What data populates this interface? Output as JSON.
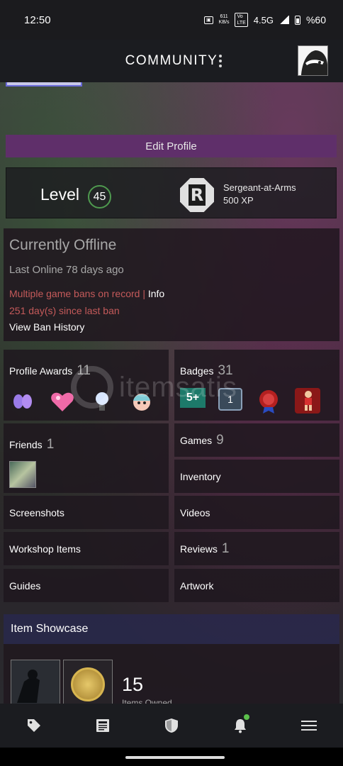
{
  "status_bar": {
    "time": "12:50",
    "net_speed_value": "611",
    "net_speed_unit": "KB/s",
    "network": "4.5G",
    "battery": "%60"
  },
  "header": {
    "title": "COMMUNITY"
  },
  "profile": {
    "edit_label": "Edit Profile",
    "level_label": "Level",
    "level_value": "45",
    "rank_letter": "R",
    "rank_title": "Sergeant-at-Arms",
    "rank_xp": "500 XP"
  },
  "status": {
    "title": "Currently Offline",
    "last_online": "Last Online 78 days ago",
    "ban_text": "Multiple game bans on record",
    "ban_separator": "|",
    "ban_info": "Info",
    "ban_days": "251 day(s) since last ban",
    "ban_history": "View Ban History"
  },
  "tiles": {
    "profile_awards": {
      "label": "Profile Awards",
      "count": "11"
    },
    "badges": {
      "label": "Badges",
      "count": "31"
    },
    "friends": {
      "label": "Friends",
      "count": "1"
    },
    "games": {
      "label": "Games",
      "count": "9"
    },
    "inventory": {
      "label": "Inventory"
    },
    "screenshots": {
      "label": "Screenshots"
    },
    "videos": {
      "label": "Videos"
    },
    "workshop": {
      "label": "Workshop Items"
    },
    "reviews": {
      "label": "Reviews",
      "count": "1"
    },
    "guides": {
      "label": "Guides"
    },
    "artwork": {
      "label": "Artwork"
    }
  },
  "badge_icons": {
    "five_plus": "5+",
    "one": "1"
  },
  "watermark": "itemsatis",
  "showcase": {
    "header": "Item Showcase",
    "count": "15",
    "count_label": "Items Owned"
  },
  "colors": {
    "accent_purple": "#5f2f6a",
    "ban_red": "#c45a5a",
    "level_ring": "#4f9a4f"
  },
  "icons": {
    "nav": [
      "tag-icon",
      "news-icon",
      "shield-icon",
      "bell-icon",
      "menu-icon"
    ]
  }
}
